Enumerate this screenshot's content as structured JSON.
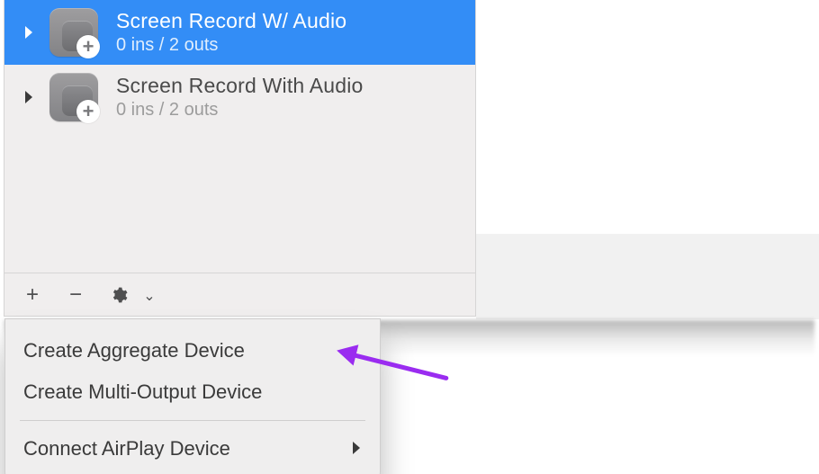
{
  "devices": [
    {
      "title": "Screen Record W/ Audio",
      "subtitle": "0 ins / 2 outs",
      "selected": true,
      "has_badge": true
    },
    {
      "title": "Screen Record With Audio",
      "subtitle": "0 ins / 2 outs",
      "selected": false,
      "has_badge": true
    }
  ],
  "toolbar": {
    "add_label": "+",
    "remove_label": "−",
    "gear_label": "settings",
    "caret": "⌄"
  },
  "menu": {
    "items": [
      {
        "label": "Create Aggregate Device",
        "has_submenu": false
      },
      {
        "label": "Create Multi-Output Device",
        "has_submenu": false
      },
      {
        "label": "Connect AirPlay Device",
        "has_submenu": true
      }
    ]
  },
  "colors": {
    "selection": "#338df6",
    "annotation_arrow": "#9a2cf0"
  }
}
